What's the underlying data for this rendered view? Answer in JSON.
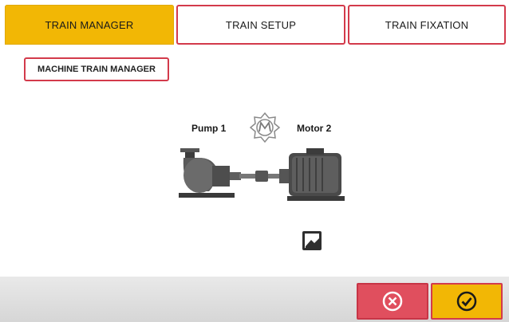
{
  "tabs": [
    {
      "label": "TRAIN MANAGER",
      "active": true
    },
    {
      "label": "TRAIN SETUP",
      "active": false
    },
    {
      "label": "TRAIN FIXATION",
      "active": false
    }
  ],
  "panel": {
    "subtitle_button": "MACHINE TRAIN MANAGER",
    "machines": {
      "pump_label": "Pump 1",
      "motor_label": "Motor 2"
    },
    "icons": {
      "badge": "gear-emblem-icon",
      "edit": "edit-machine-icon"
    }
  },
  "footer": {
    "cancel_icon": "cancel-icon",
    "confirm_icon": "checkmark-icon"
  },
  "colors": {
    "accent_yellow": "#f2b705",
    "accent_red": "#d33a4b",
    "cancel_red": "#e04f5e"
  }
}
